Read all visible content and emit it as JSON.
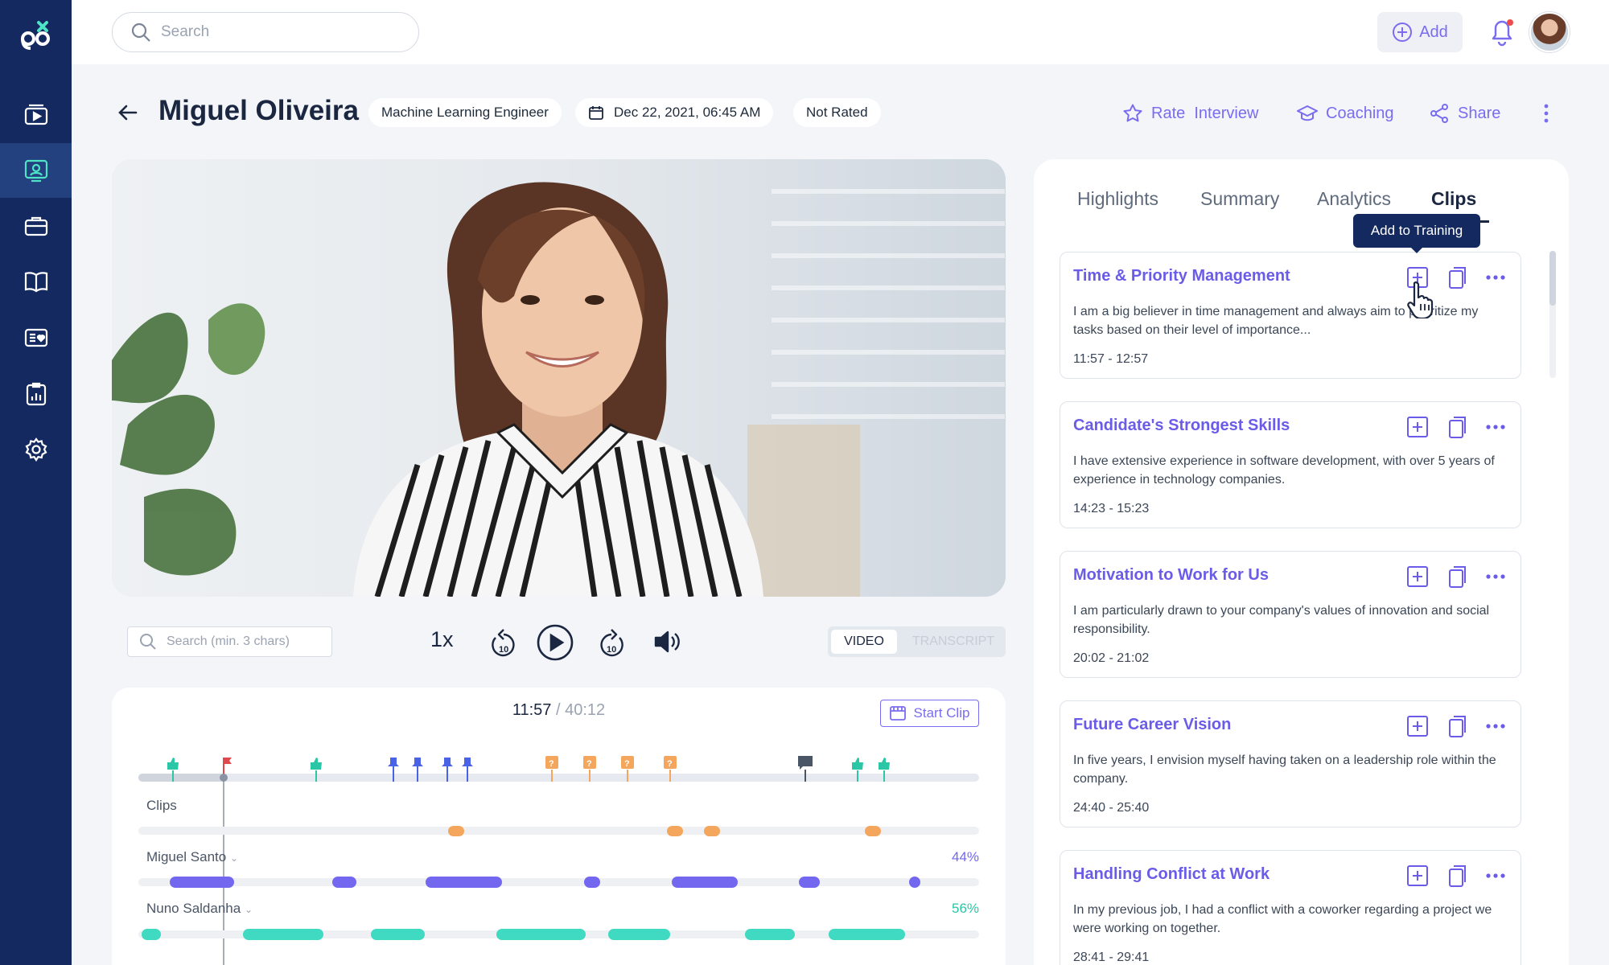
{
  "topbar": {
    "search_placeholder": "Search",
    "add_label": "Add"
  },
  "header": {
    "candidate_name": "Miguel Oliveira",
    "role": "Machine Learning Engineer",
    "datetime": "Dec 22, 2021, 06:45 AM",
    "rating": "Not Rated",
    "rate_label": "Rate  Interview",
    "coaching_label": "Coaching",
    "share_label": "Share"
  },
  "player": {
    "search_placeholder": "Search (min. 3 chars)",
    "speed": "1x",
    "view_video": "VIDEO",
    "view_transcript": "TRANSCRIPT",
    "current_time": "11:57",
    "total_time": " / 40:12",
    "start_clip_label": "Start Clip"
  },
  "timeline": {
    "clips_label": "Clips",
    "speakers": [
      {
        "name": "Miguel Santo",
        "percent": "44%",
        "color": "#7367f0"
      },
      {
        "name": "Nuno Saldanha",
        "percent": "56%",
        "color": "#3fdac1"
      }
    ]
  },
  "tabs": [
    "Highlights",
    "Summary",
    "Analytics",
    "Clips"
  ],
  "active_tab": "Clips",
  "tooltip": "Add to Training",
  "clips": [
    {
      "title": "Time & Priority Management",
      "text": "I am a big believer in time management and always aim to prioritize my tasks based on their level of importance...",
      "time": "11:57 - 12:57"
    },
    {
      "title": "Candidate's Strongest Skills",
      "text": "I have extensive experience in software development, with over 5 years of experience in technology companies.",
      "time": "14:23 - 15:23"
    },
    {
      "title": "Motivation to Work for Us",
      "text": "I am particularly drawn to your company's values of innovation and social responsibility.",
      "time": "20:02 - 21:02"
    },
    {
      "title": "Future Career Vision",
      "text": "In five years, I envision myself having taken on a leadership role within the company.",
      "time": "24:40 - 25:40"
    },
    {
      "title": "Handling Conflict at Work",
      "text": "In my previous job, I had a conflict with a coworker regarding a project we were working on together.",
      "time": "28:41 - 29:41"
    }
  ],
  "colors": {
    "sidebar": "#13295f",
    "accent": "#7a6cf0",
    "speaker1": "#7367f0",
    "speaker2": "#3fdac1",
    "question": "#f4a65d"
  }
}
